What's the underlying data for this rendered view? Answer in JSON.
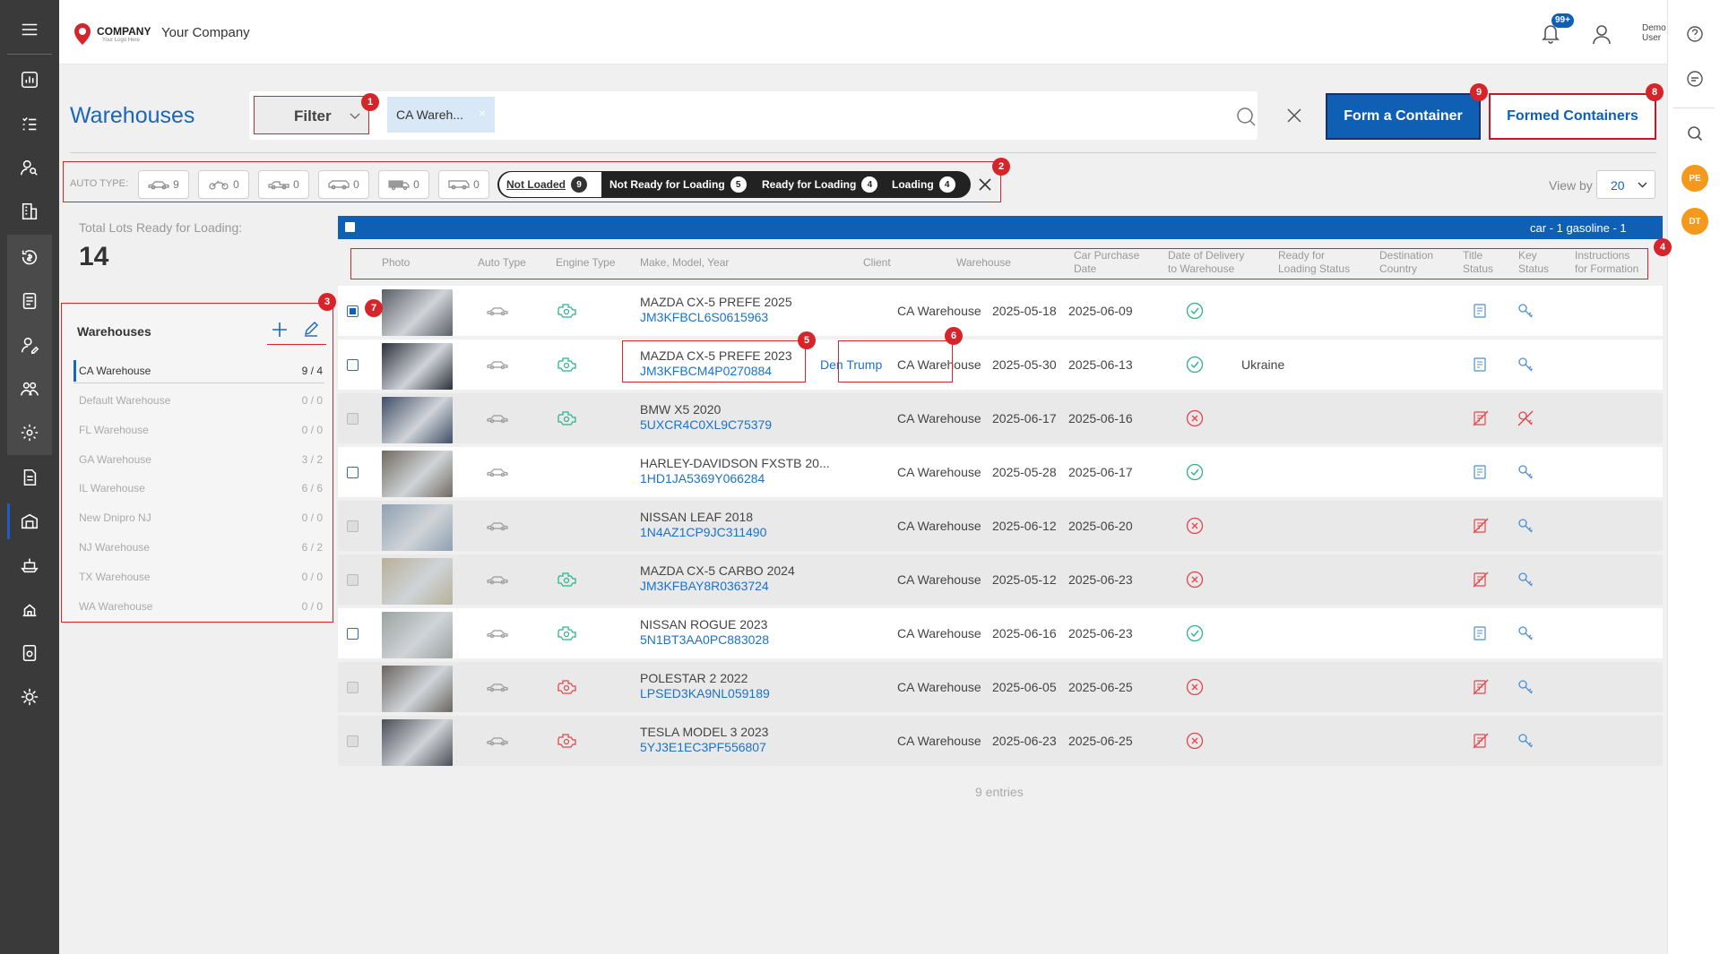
{
  "company": {
    "logo_text": "COMPANY",
    "logo_sub": "Your Logo Here",
    "name": "Your Company"
  },
  "user": {
    "notifications": "99+",
    "name_line1": "Demo",
    "name_line2": "User"
  },
  "page": {
    "title": "Warehouses"
  },
  "filter": {
    "label": "Filter",
    "chip": "CA Wareh..."
  },
  "actions": {
    "form_container": "Form a Container",
    "formed_containers": "Formed Containers"
  },
  "auto_type": {
    "label": "AUTO TYPE:",
    "types": [
      {
        "icon": "sedan-icon",
        "count": "9"
      },
      {
        "icon": "motorcycle-icon",
        "count": "0"
      },
      {
        "icon": "pickup-icon",
        "count": "0"
      },
      {
        "icon": "suv-icon",
        "count": "0"
      },
      {
        "icon": "truck-icon",
        "count": "0"
      },
      {
        "icon": "van-icon",
        "count": "0"
      }
    ]
  },
  "statuses": [
    {
      "label": "Not Loaded",
      "count": "9"
    },
    {
      "label": "Not Ready for Loading",
      "count": "5"
    },
    {
      "label": "Ready for Loading",
      "count": "4"
    },
    {
      "label": "Loading",
      "count": "4"
    }
  ],
  "view_by": {
    "label": "View by",
    "value": "20"
  },
  "total_lots": {
    "label": "Total Lots Ready for Loading:",
    "value": "14"
  },
  "warehouses_panel": {
    "title": "Warehouses",
    "items": [
      {
        "name": "CA Warehouse",
        "count": "9 / 4"
      },
      {
        "name": "Default Warehouse",
        "count": "0 / 0"
      },
      {
        "name": "FL Warehouse",
        "count": "0 / 0"
      },
      {
        "name": "GA Warehouse",
        "count": "3 / 2"
      },
      {
        "name": "IL Warehouse",
        "count": "6 / 6"
      },
      {
        "name": "New Dnipro NJ",
        "count": "0 / 0"
      },
      {
        "name": "NJ Warehouse",
        "count": "6 / 2"
      },
      {
        "name": "TX Warehouse",
        "count": "0 / 0"
      },
      {
        "name": "WA Warehouse",
        "count": "0 / 0"
      }
    ]
  },
  "summary_bar": {
    "text": "car - 1 gasoline - 1"
  },
  "table": {
    "columns": {
      "photo": "Photo",
      "auto_type": "Auto Type",
      "engine_type": "Engine Type",
      "make": "Make, Model, Year",
      "client": "Client",
      "warehouse": "Warehouse",
      "purchase_1": "Car Purchase",
      "purchase_2": "Date",
      "delivery_1": "Date of Delivery",
      "delivery_2": "to Warehouse",
      "ready_1": "Ready for",
      "ready_2": "Loading Status",
      "dest_1": "Destination",
      "dest_2": "Country",
      "title_1": "Title",
      "title_2": "Status",
      "key_1": "Key",
      "key_2": "Status",
      "instr_1": "Instructions",
      "instr_2": "for Formation"
    },
    "rows": [
      {
        "model": "MAZDA CX-5 PREFE 2025",
        "vin": "JM3KFBCL6S0615963",
        "client": "",
        "warehouse": "CA Warehouse",
        "purchase": "2025-05-18",
        "delivery": "2025-06-09",
        "ready": true,
        "country": "",
        "engine": "green",
        "checked": true
      },
      {
        "model": "MAZDA CX-5 PREFE 2023",
        "vin": "JM3KFBCM4P0270884",
        "client": "Den Trump",
        "warehouse": "CA Warehouse",
        "purchase": "2025-05-30",
        "delivery": "2025-06-13",
        "ready": true,
        "country": "Ukraine",
        "engine": "green",
        "checked": false
      },
      {
        "model": "BMW X5 2020",
        "vin": "5UXCR4C0XL9C75379",
        "client": "",
        "warehouse": "CA Warehouse",
        "purchase": "2025-06-17",
        "delivery": "2025-06-16",
        "ready": false,
        "country": "",
        "engine": "green",
        "checked": false
      },
      {
        "model": "HARLEY-DAVIDSON FXSTB 20...",
        "vin": "1HD1JA5369Y066284",
        "client": "",
        "warehouse": "CA Warehouse",
        "purchase": "2025-05-28",
        "delivery": "2025-06-17",
        "ready": true,
        "country": "",
        "engine": "none",
        "checked": false
      },
      {
        "model": "NISSAN LEAF 2018",
        "vin": "1N4AZ1CP9JC311490",
        "client": "",
        "warehouse": "CA Warehouse",
        "purchase": "2025-06-12",
        "delivery": "2025-06-20",
        "ready": false,
        "country": "",
        "engine": "none",
        "checked": false
      },
      {
        "model": "MAZDA CX-5 CARBO 2024",
        "vin": "JM3KFBAY8R0363724",
        "client": "",
        "warehouse": "CA Warehouse",
        "purchase": "2025-05-12",
        "delivery": "2025-06-23",
        "ready": false,
        "country": "",
        "engine": "green",
        "checked": false
      },
      {
        "model": "NISSAN ROGUE 2023",
        "vin": "5N1BT3AA0PC883028",
        "client": "",
        "warehouse": "CA Warehouse",
        "purchase": "2025-06-16",
        "delivery": "2025-06-23",
        "ready": true,
        "country": "",
        "engine": "green",
        "checked": false
      },
      {
        "model": "POLESTAR 2 2022",
        "vin": "LPSED3KA9NL059189",
        "client": "",
        "warehouse": "CA Warehouse",
        "purchase": "2025-06-05",
        "delivery": "2025-06-25",
        "ready": false,
        "country": "",
        "engine": "red",
        "checked": false
      },
      {
        "model": "TESLA MODEL 3 2023",
        "vin": "5YJ3E1EC3PF556807",
        "client": "",
        "warehouse": "CA Warehouse",
        "purchase": "2025-06-23",
        "delivery": "2025-06-25",
        "ready": false,
        "country": "",
        "engine": "red",
        "checked": false
      }
    ],
    "entries": "9 entries"
  },
  "annotations": [
    "1",
    "2",
    "3",
    "4",
    "5",
    "6",
    "7",
    "8",
    "9"
  ],
  "right_avatars": [
    "PE",
    "DT"
  ],
  "colors": {
    "primary": "#0f5fb5",
    "annotation": "#d6242b",
    "ok": "#2bb58a",
    "bad": "#e0484f",
    "sidebar": "#3a3a3a"
  }
}
